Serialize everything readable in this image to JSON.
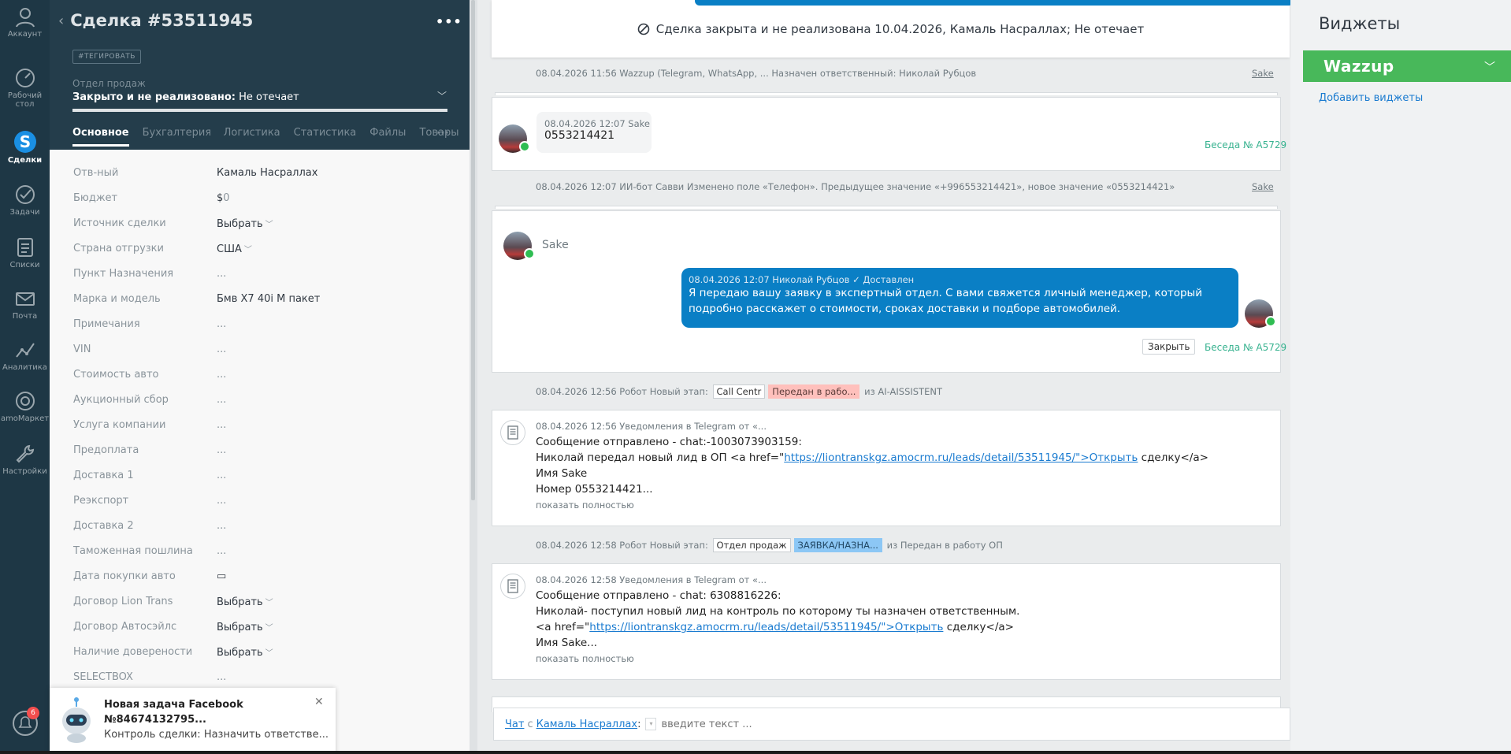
{
  "nav": {
    "items": [
      {
        "label": "Аккаунт",
        "icon": "account-icon"
      },
      {
        "label": "Рабочий стол",
        "icon": "dashboard-icon"
      },
      {
        "label": "Сделки",
        "icon": "deals-icon"
      },
      {
        "label": "Задачи",
        "icon": "tasks-icon"
      },
      {
        "label": "Списки",
        "icon": "lists-icon"
      },
      {
        "label": "Почта",
        "icon": "mail-icon"
      },
      {
        "label": "Аналитика",
        "icon": "analytics-icon"
      },
      {
        "label": "amoМаркет",
        "icon": "market-icon"
      },
      {
        "label": "Настройки",
        "icon": "settings-icon"
      }
    ],
    "notifications_count": "6"
  },
  "lead": {
    "title": "Сделка #53511945",
    "tag": "#ТЕГИРОВАТЬ",
    "pipeline_label": "Отдел продаж",
    "status_bold": "Закрыто и не реализовано:",
    "status_reason": " Не отечает",
    "tabs": [
      "Основное",
      "Бухгалтерия",
      "Логистика",
      "Статистика",
      "Файлы",
      "Товары"
    ],
    "fields": [
      {
        "name": "Отв-ный",
        "value": "Камаль Насраллах"
      },
      {
        "name": "Бюджет",
        "value": "$",
        "extra": "0"
      },
      {
        "name": "Источник сделки",
        "value": "Выбрать",
        "chev": true
      },
      {
        "name": "Страна отгрузки",
        "value": "США",
        "chev": true
      },
      {
        "name": "Пункт Назначения",
        "value": "..."
      },
      {
        "name": "Марка и модель",
        "value": "Бмв Х7 40i M пакет"
      },
      {
        "name": "Примечания",
        "value": "..."
      },
      {
        "name": "VIN",
        "value": "..."
      },
      {
        "name": "Стоимость авто",
        "value": "..."
      },
      {
        "name": "Аукционный сбор",
        "value": "..."
      },
      {
        "name": "Услуга компании",
        "value": "..."
      },
      {
        "name": "Предоплата",
        "value": "..."
      },
      {
        "name": "Доставка 1",
        "value": "..."
      },
      {
        "name": "Реэкспорт",
        "value": "..."
      },
      {
        "name": "Доставка 2",
        "value": "..."
      },
      {
        "name": "Таможенная пошлина",
        "value": "..."
      },
      {
        "name": "Дата покупки авто",
        "value": "▭"
      },
      {
        "name": "Договор Lion Trans",
        "value": "Выбрать",
        "chev": true
      },
      {
        "name": "Договор Автосэйлс",
        "value": "Выбрать",
        "chev": true
      },
      {
        "name": "Наличие доверености",
        "value": "Выбрать",
        "chev": true
      },
      {
        "name": "SELECTBOX",
        "value": "..."
      }
    ]
  },
  "toast": {
    "title": "Новая задача Facebook №84674132795...",
    "text": "Контроль сделки: Назначить ответстве..."
  },
  "feed": {
    "closed_banner": "Сделка закрыта и не реализована 10.04.2026, Камаль Насраллах; Не отечает",
    "note1": "08.04.2026 11:56 Wazzup (Telegram, WhatsApp, ... Назначен ответственный: Николай Рубцов",
    "note1_author": "Sake",
    "msg1_meta": "08.04.2026 12:07 Sake",
    "msg1_text": "0553214421",
    "conv_label": "Беседа № A5729",
    "note2": "08.04.2026 12:07 ИИ-бот Савви Изменено поле «Телефон». Предыдущее значение «+996553214421», новое значение «0553214421»",
    "note2_author": "Sake",
    "chat_contact": "Sake",
    "msg2_meta": "08.04.2026 12:07 Николай Рубцов",
    "msg2_status": "✓ Доставлен",
    "msg2_text": "Я передаю вашу заявку в экспертный отдел. С вами свяжется личный менеджер, который подробно расскажет о стоимости, сроках доставки и подборе автомобилей.",
    "close_label": "Закрыть",
    "stage1_prefix": "08.04.2026 12:56 Робот Новый этап:",
    "stage1_from": "Call Centr",
    "stage1_to": "Передан в рабо...",
    "stage1_suffix": "из AI-AISSISTENT",
    "sys1_meta": "08.04.2026 12:56 Уведомления в Telegram от «...",
    "sys1_line1": "Сообщение отправлено - chat:-1003073903159:",
    "sys1_line2_a": "Николай передал новый лид в ОП <a href=\"",
    "sys1_link": "https://liontranskgz.amocrm.ru/leads/detail/53511945/\">Открыть",
    "sys1_line2_b": " сделку</a>",
    "sys1_line3": "Имя Sake",
    "sys1_line4": "Номер 0553214421...",
    "show_more": "показать полностью",
    "stage2_prefix": "08.04.2026 12:58 Робот Новый этап:",
    "stage2_from": "Отдел продаж",
    "stage2_to": "ЗАЯВКА/НАЗНА...",
    "stage2_suffix": "из Передан в работу ОП",
    "sys2_meta": "08.04.2026 12:58 Уведомления в Telegram от «...",
    "sys2_line1": "Сообщение отправлено - chat: 6308816226:",
    "sys2_line2": "Николай- поступил новый лид на контроль по которому ты назначен ответственным.",
    "sys2_line3_a": "<a href=\"",
    "sys2_link": "https://liontranskgz.amocrm.ru/leads/detail/53511945/\">Открыть",
    "sys2_line3_b": " сделку</a>",
    "sys2_line4": "Имя Sake...",
    "chat_bar": {
      "chat_link": "Чат",
      "with": "с",
      "contact_link": "Камаль Насраллах",
      "colon": ":",
      "placeholder": "введите текст ..."
    }
  },
  "widgets": {
    "title": "Виджеты",
    "wazzup": "Wazzup",
    "add": "Добавить виджеты"
  }
}
